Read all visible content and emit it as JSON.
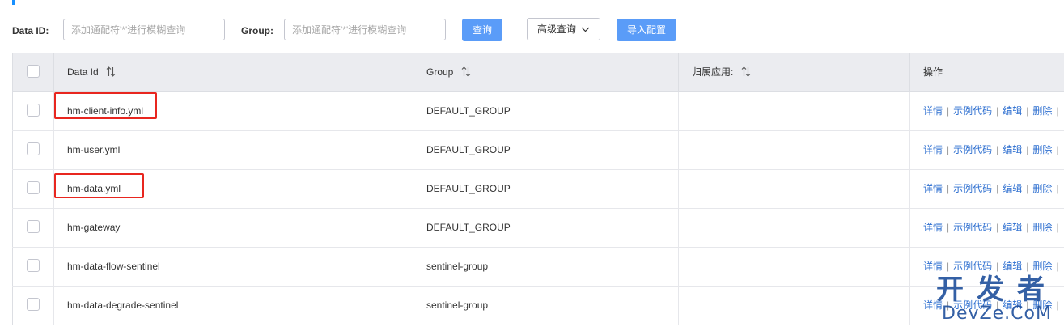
{
  "filters": {
    "data_id_label": "Data ID:",
    "data_id_placeholder": "添加通配符'*'进行模糊查询",
    "group_label": "Group:",
    "group_placeholder": "添加通配符'*'进行模糊查询",
    "search_button": "查询",
    "advanced_button": "高级查询",
    "import_button": "导入配置"
  },
  "table": {
    "headers": {
      "data_id": "Data Id",
      "group": "Group",
      "app": "归属应用:",
      "ops": "操作"
    },
    "ops_labels": {
      "detail": "详情",
      "sample": "示例代码",
      "edit": "编辑",
      "delete": "删除",
      "sep": "|"
    },
    "rows": [
      {
        "data_id": "hm-client-info.yml",
        "group": "DEFAULT_GROUP",
        "app": ""
      },
      {
        "data_id": "hm-user.yml",
        "group": "DEFAULT_GROUP",
        "app": ""
      },
      {
        "data_id": "hm-data.yml",
        "group": "DEFAULT_GROUP",
        "app": ""
      },
      {
        "data_id": "hm-gateway",
        "group": "DEFAULT_GROUP",
        "app": ""
      },
      {
        "data_id": "hm-data-flow-sentinel",
        "group": "sentinel-group",
        "app": ""
      },
      {
        "data_id": "hm-data-degrade-sentinel",
        "group": "sentinel-group",
        "app": ""
      }
    ]
  },
  "watermark": {
    "line1": "开发者",
    "line2": "DevZe.CoM"
  },
  "colors": {
    "primary": "#5a9cf8",
    "link": "#2e6fd0",
    "highlight": "#e8261f",
    "header_bg": "#ebecf0"
  },
  "icons": {
    "sort": "sort-arrows-icon",
    "chevron": "chevron-down-icon"
  }
}
